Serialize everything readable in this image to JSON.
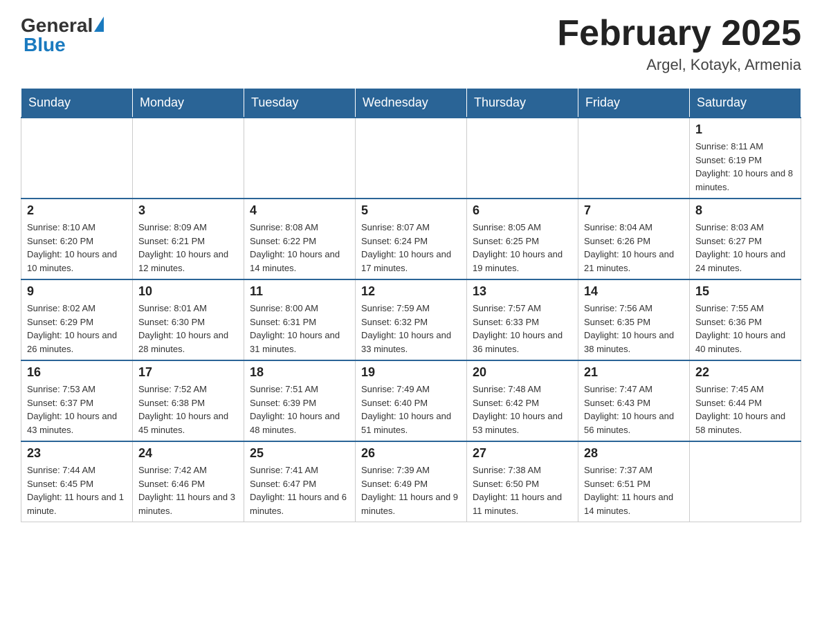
{
  "header": {
    "logo_general": "General",
    "logo_blue": "Blue",
    "title": "February 2025",
    "location": "Argel, Kotayk, Armenia"
  },
  "weekdays": [
    "Sunday",
    "Monday",
    "Tuesday",
    "Wednesday",
    "Thursday",
    "Friday",
    "Saturday"
  ],
  "weeks": [
    [
      {
        "day": "",
        "info": ""
      },
      {
        "day": "",
        "info": ""
      },
      {
        "day": "",
        "info": ""
      },
      {
        "day": "",
        "info": ""
      },
      {
        "day": "",
        "info": ""
      },
      {
        "day": "",
        "info": ""
      },
      {
        "day": "1",
        "info": "Sunrise: 8:11 AM\nSunset: 6:19 PM\nDaylight: 10 hours and 8 minutes."
      }
    ],
    [
      {
        "day": "2",
        "info": "Sunrise: 8:10 AM\nSunset: 6:20 PM\nDaylight: 10 hours and 10 minutes."
      },
      {
        "day": "3",
        "info": "Sunrise: 8:09 AM\nSunset: 6:21 PM\nDaylight: 10 hours and 12 minutes."
      },
      {
        "day": "4",
        "info": "Sunrise: 8:08 AM\nSunset: 6:22 PM\nDaylight: 10 hours and 14 minutes."
      },
      {
        "day": "5",
        "info": "Sunrise: 8:07 AM\nSunset: 6:24 PM\nDaylight: 10 hours and 17 minutes."
      },
      {
        "day": "6",
        "info": "Sunrise: 8:05 AM\nSunset: 6:25 PM\nDaylight: 10 hours and 19 minutes."
      },
      {
        "day": "7",
        "info": "Sunrise: 8:04 AM\nSunset: 6:26 PM\nDaylight: 10 hours and 21 minutes."
      },
      {
        "day": "8",
        "info": "Sunrise: 8:03 AM\nSunset: 6:27 PM\nDaylight: 10 hours and 24 minutes."
      }
    ],
    [
      {
        "day": "9",
        "info": "Sunrise: 8:02 AM\nSunset: 6:29 PM\nDaylight: 10 hours and 26 minutes."
      },
      {
        "day": "10",
        "info": "Sunrise: 8:01 AM\nSunset: 6:30 PM\nDaylight: 10 hours and 28 minutes."
      },
      {
        "day": "11",
        "info": "Sunrise: 8:00 AM\nSunset: 6:31 PM\nDaylight: 10 hours and 31 minutes."
      },
      {
        "day": "12",
        "info": "Sunrise: 7:59 AM\nSunset: 6:32 PM\nDaylight: 10 hours and 33 minutes."
      },
      {
        "day": "13",
        "info": "Sunrise: 7:57 AM\nSunset: 6:33 PM\nDaylight: 10 hours and 36 minutes."
      },
      {
        "day": "14",
        "info": "Sunrise: 7:56 AM\nSunset: 6:35 PM\nDaylight: 10 hours and 38 minutes."
      },
      {
        "day": "15",
        "info": "Sunrise: 7:55 AM\nSunset: 6:36 PM\nDaylight: 10 hours and 40 minutes."
      }
    ],
    [
      {
        "day": "16",
        "info": "Sunrise: 7:53 AM\nSunset: 6:37 PM\nDaylight: 10 hours and 43 minutes."
      },
      {
        "day": "17",
        "info": "Sunrise: 7:52 AM\nSunset: 6:38 PM\nDaylight: 10 hours and 45 minutes."
      },
      {
        "day": "18",
        "info": "Sunrise: 7:51 AM\nSunset: 6:39 PM\nDaylight: 10 hours and 48 minutes."
      },
      {
        "day": "19",
        "info": "Sunrise: 7:49 AM\nSunset: 6:40 PM\nDaylight: 10 hours and 51 minutes."
      },
      {
        "day": "20",
        "info": "Sunrise: 7:48 AM\nSunset: 6:42 PM\nDaylight: 10 hours and 53 minutes."
      },
      {
        "day": "21",
        "info": "Sunrise: 7:47 AM\nSunset: 6:43 PM\nDaylight: 10 hours and 56 minutes."
      },
      {
        "day": "22",
        "info": "Sunrise: 7:45 AM\nSunset: 6:44 PM\nDaylight: 10 hours and 58 minutes."
      }
    ],
    [
      {
        "day": "23",
        "info": "Sunrise: 7:44 AM\nSunset: 6:45 PM\nDaylight: 11 hours and 1 minute."
      },
      {
        "day": "24",
        "info": "Sunrise: 7:42 AM\nSunset: 6:46 PM\nDaylight: 11 hours and 3 minutes."
      },
      {
        "day": "25",
        "info": "Sunrise: 7:41 AM\nSunset: 6:47 PM\nDaylight: 11 hours and 6 minutes."
      },
      {
        "day": "26",
        "info": "Sunrise: 7:39 AM\nSunset: 6:49 PM\nDaylight: 11 hours and 9 minutes."
      },
      {
        "day": "27",
        "info": "Sunrise: 7:38 AM\nSunset: 6:50 PM\nDaylight: 11 hours and 11 minutes."
      },
      {
        "day": "28",
        "info": "Sunrise: 7:37 AM\nSunset: 6:51 PM\nDaylight: 11 hours and 14 minutes."
      },
      {
        "day": "",
        "info": ""
      }
    ]
  ]
}
